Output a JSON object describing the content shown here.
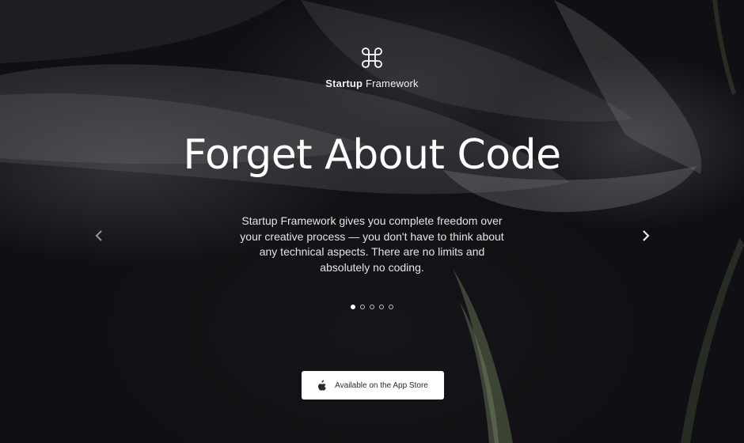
{
  "brand": {
    "icon": "command-icon",
    "name_bold": "Startup",
    "name_rest": " Framework"
  },
  "hero": {
    "headline": "Forget About Code",
    "description": "Startup Framework gives you complete freedom over your creative process — you don't have to think about any technical aspects. There are no limits and absolutely no coding."
  },
  "carousel": {
    "prev_icon": "chevron-left-icon",
    "next_icon": "chevron-right-icon",
    "slide_count": 5,
    "active_index": 0
  },
  "cta": {
    "icon": "apple-icon",
    "label": "Available on the App Store"
  },
  "colors": {
    "background": "#17161a",
    "text": "#ffffff",
    "button_bg": "#ffffff",
    "button_text": "#2a2a2e"
  }
}
